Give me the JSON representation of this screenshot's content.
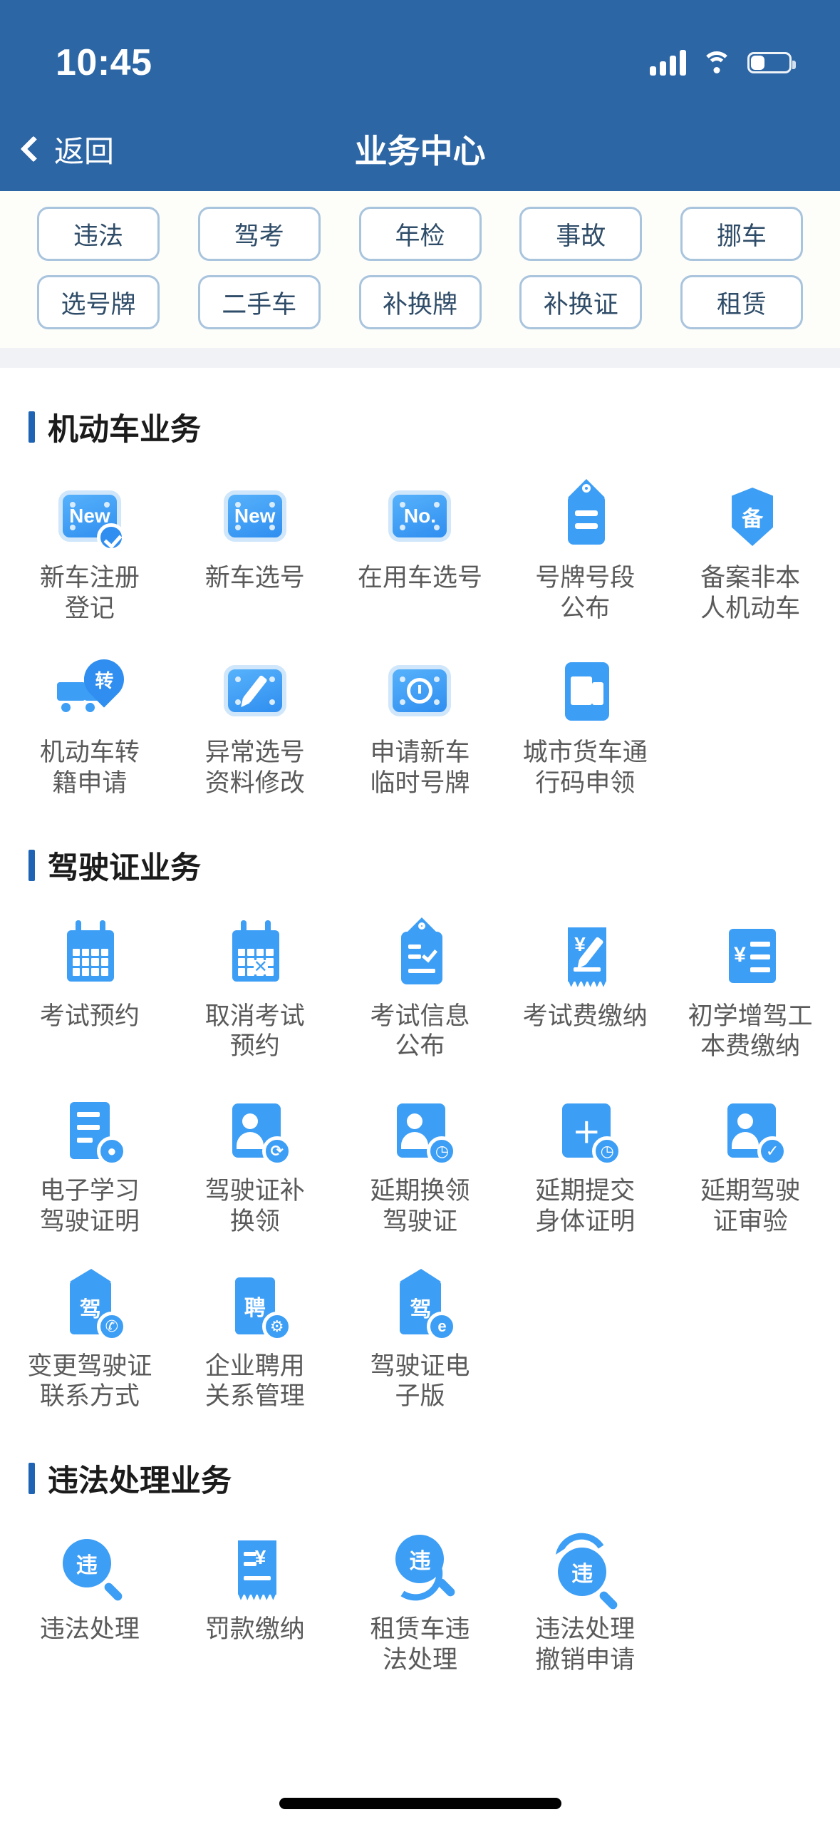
{
  "status_bar": {
    "time": "10:45",
    "signal_icon": "signal-bars-icon",
    "wifi_icon": "wifi-icon",
    "battery_icon": "battery-icon",
    "battery_level_pct": 34
  },
  "nav": {
    "back_label": "返回",
    "title": "业务中心",
    "back_icon": "chevron-left-icon"
  },
  "colors": {
    "header_blue": "#2c66a5",
    "icon_blue": "#3d9ef5",
    "accent_bar": "#1f64b4",
    "chip_border": "#a9c4dd",
    "label_gray": "#5a5a5a"
  },
  "chips": {
    "row1": [
      "违法",
      "驾考",
      "年检",
      "事故",
      "挪车"
    ],
    "row2": [
      "选号牌",
      "二手车",
      "补换牌",
      "补换证",
      "租赁"
    ]
  },
  "sections": [
    {
      "title": "机动车业务",
      "items": [
        {
          "label": "新车注册\n登记",
          "icon": "new-plate-check-icon"
        },
        {
          "label": "新车选号",
          "icon": "new-plate-icon"
        },
        {
          "label": "在用车选号",
          "icon": "no-plate-icon"
        },
        {
          "label": "号牌号段\n公布",
          "icon": "tag-lines-icon"
        },
        {
          "label": "备案非本\n人机动车",
          "icon": "shield-bei-icon"
        },
        {
          "label": "机动车转\n籍申请",
          "icon": "truck-transfer-icon"
        },
        {
          "label": "异常选号\n资料修改",
          "icon": "plate-pencil-icon"
        },
        {
          "label": "申请新车\n临时号牌",
          "icon": "plate-clock-icon"
        },
        {
          "label": "城市货车通\n行码申领",
          "icon": "van-card-icon"
        }
      ]
    },
    {
      "title": "驾驶证业务",
      "items": [
        {
          "label": "考试预约",
          "icon": "calendar-icon"
        },
        {
          "label": "取消考试\n预约",
          "icon": "calendar-cancel-icon"
        },
        {
          "label": "考试信息\n公布",
          "icon": "clipboard-check-icon"
        },
        {
          "label": "考试费缴纳",
          "icon": "receipt-yuan-pencil-icon"
        },
        {
          "label": "初学增驾工\n本费缴纳",
          "icon": "yuan-list-icon"
        },
        {
          "label": "电子学习\n驾驶证明",
          "icon": "document-person-icon"
        },
        {
          "label": "驾驶证补\n换领",
          "icon": "person-refresh-icon"
        },
        {
          "label": "延期换领\n驾驶证",
          "icon": "person-clock-icon"
        },
        {
          "label": "延期提交\n身体证明",
          "icon": "plus-clock-icon"
        },
        {
          "label": "延期驾驶\n证审验",
          "icon": "person-check-icon"
        },
        {
          "label": "变更驾驶证\n联系方式",
          "icon": "license-phone-icon"
        },
        {
          "label": "企业聘用\n关系管理",
          "icon": "hire-gear-icon"
        },
        {
          "label": "驾驶证电\n子版",
          "icon": "license-e-icon"
        }
      ]
    },
    {
      "title": "违法处理业务",
      "items": [
        {
          "label": "违法处理",
          "icon": "violation-search-icon"
        },
        {
          "label": "罚款缴纳",
          "icon": "fine-receipt-icon"
        },
        {
          "label": "租赁车违\n法处理",
          "icon": "violation-rental-icon"
        },
        {
          "label": "违法处理\n撤销申请",
          "icon": "violation-revoke-icon"
        }
      ]
    }
  ]
}
